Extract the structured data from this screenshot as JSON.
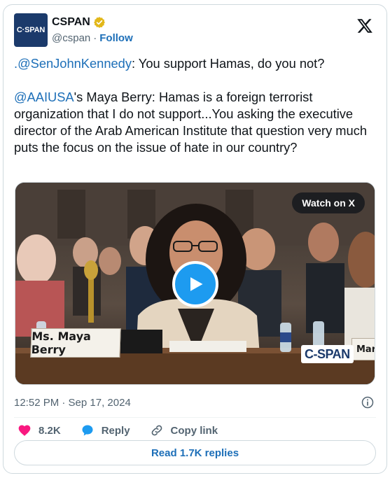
{
  "account": {
    "avatar_text": "C·SPAN",
    "display_name": "CSPAN",
    "handle": "@cspan",
    "separator": "·",
    "follow_label": "Follow"
  },
  "tweet": {
    "line1_mention": ".@SenJohnKennedy",
    "line1_text": ": You support Hamas, do you not?",
    "para2_mention": "@AAIUSA",
    "para2_text": "'s Maya Berry: Hamas is a foreign terrorist organization that I do not support...You asking the executive director of the Arab American Institute that question very much puts the focus on the issue of hate in our country?"
  },
  "media": {
    "watch_label": "Watch on X",
    "nameplate": "Ms. Maya Berry",
    "nameplate2": "Mark C",
    "bug": "C-SPAN"
  },
  "timestamp": "12:52 PM · Sep 17, 2024",
  "actions": {
    "like_count": "8.2K",
    "reply_label": "Reply",
    "copy_link_label": "Copy link"
  },
  "read_replies_label": "Read 1.7K replies",
  "colors": {
    "link": "#1d6fb8",
    "like": "#f91880",
    "play": "#1d9bf0",
    "verified": "#e2b719"
  }
}
